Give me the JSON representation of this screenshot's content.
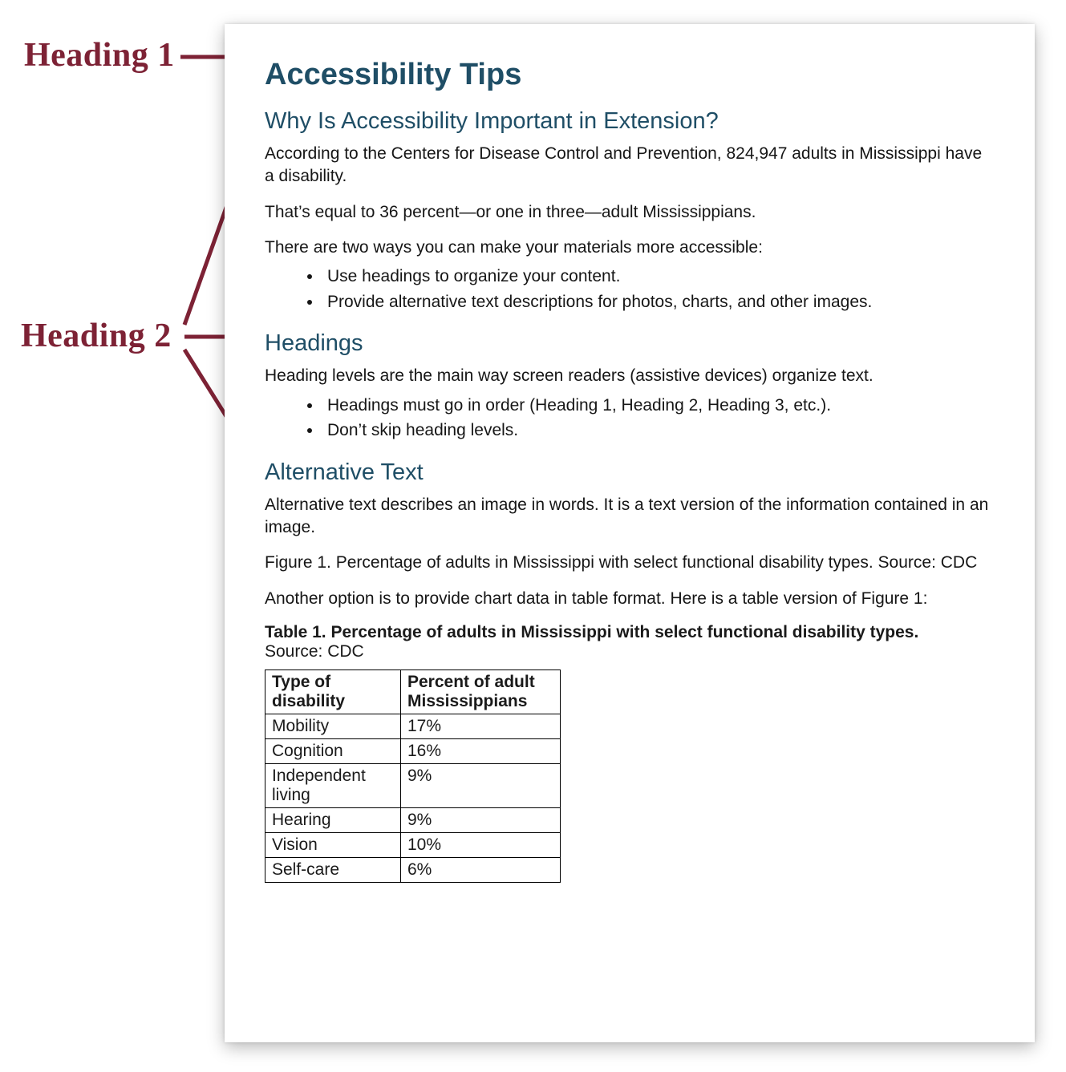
{
  "annotations": {
    "heading1_label": "Heading 1",
    "heading2_label": "Heading 2"
  },
  "doc": {
    "h1": "Accessibility Tips",
    "sec1": {
      "h2": "Why Is Accessibility Important in Extension?",
      "p1": "According to the Centers for Disease Control and Prevention, 824,947 adults in Mississippi have a disability.",
      "p2": "That’s equal to 36 percent—or one in three—adult Mississippians.",
      "p3": "There are two ways you can make your materials more accessible:",
      "bullets": [
        "Use headings to organize your content.",
        "Provide alternative text descriptions for photos, charts, and other images."
      ]
    },
    "sec2": {
      "h2": "Headings",
      "p1": "Heading levels are the main way screen readers (assistive devices) organize text.",
      "bullets": [
        "Headings must go in order (Heading 1, Heading 2, Heading 3, etc.).",
        "Don’t skip heading levels."
      ]
    },
    "sec3": {
      "h2": "Alternative Text",
      "p1": "Alternative text describes an image in words. It is a text version of the information contained in an image.",
      "figcap": "Figure 1. Percentage of adults in Mississippi with select functional disability types. Source: CDC",
      "p2": "Another option is to provide chart data in table format. Here is a table version of Figure 1:",
      "tablecap_bold": "Table 1. Percentage of adults in Mississippi with select functional disability types.",
      "tablecap_src": "Source: CDC",
      "table": {
        "headers": [
          "Type of disability",
          "Percent of adult Mississippians"
        ],
        "rows": [
          [
            "Mobility",
            "17%"
          ],
          [
            "Cognition",
            "16%"
          ],
          [
            "Independent living",
            "9%"
          ],
          [
            "Hearing",
            "9%"
          ],
          [
            "Vision",
            "10%"
          ],
          [
            "Self-care",
            "6%"
          ]
        ]
      }
    }
  },
  "chart_data": {
    "type": "table",
    "title": "Percentage of adults in Mississippi with select functional disability types",
    "source": "CDC",
    "columns": [
      "Type of disability",
      "Percent of adult Mississippians"
    ],
    "rows": [
      {
        "type": "Mobility",
        "percent": 17
      },
      {
        "type": "Cognition",
        "percent": 16
      },
      {
        "type": "Independent living",
        "percent": 9
      },
      {
        "type": "Hearing",
        "percent": 9
      },
      {
        "type": "Vision",
        "percent": 10
      },
      {
        "type": "Self-care",
        "percent": 6
      }
    ]
  },
  "colors": {
    "heading_blue": "#1F4E66",
    "annotation_maroon": "#7D2235"
  }
}
